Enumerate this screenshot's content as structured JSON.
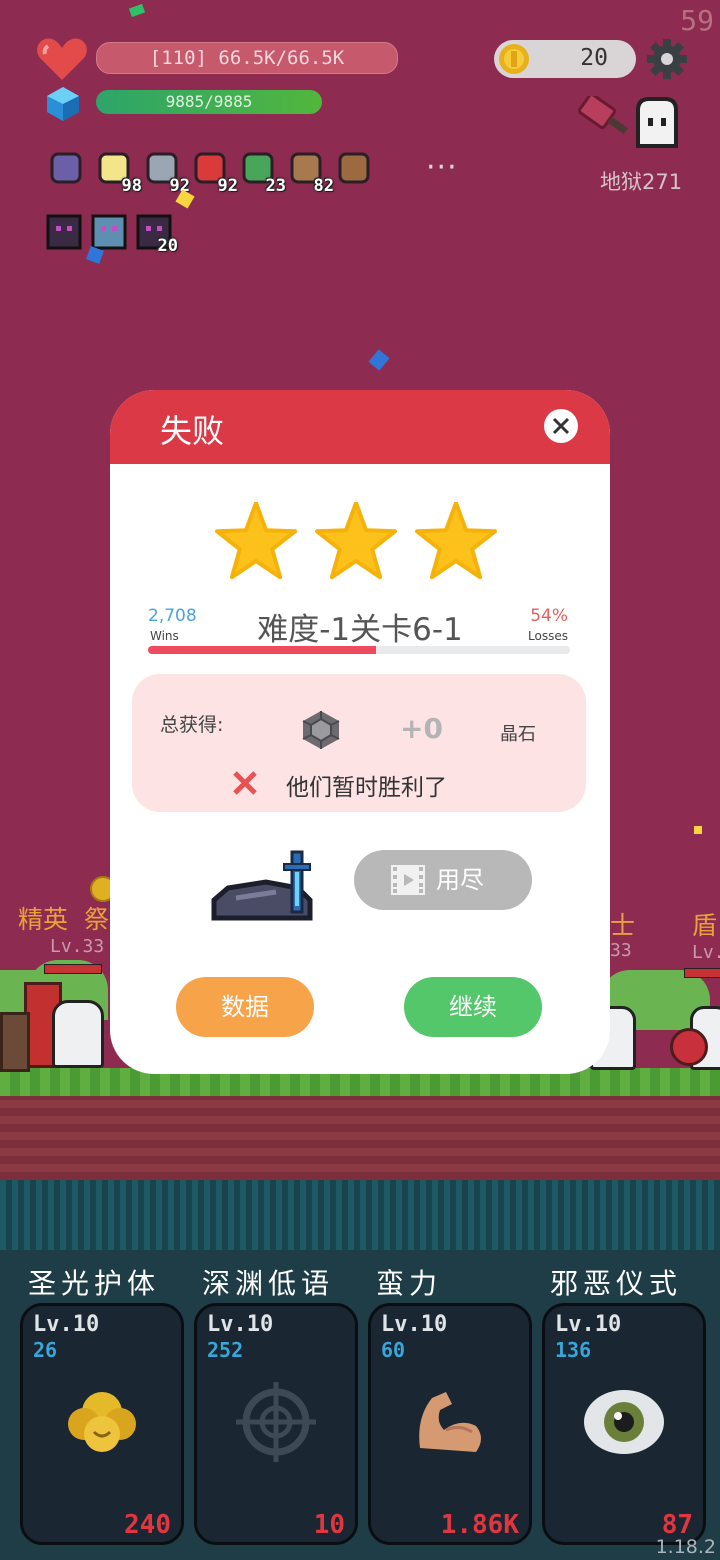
{
  "hud": {
    "fps": "59",
    "hp_text": "[110] 66.5K/66.5K",
    "mana_text": "9885/9885",
    "coins": "20",
    "stage_label": "地狱271",
    "more": "···",
    "items": [
      {
        "icon": "scroll-icon",
        "count": ""
      },
      {
        "icon": "flower-icon",
        "count": "98"
      },
      {
        "icon": "sword-icon",
        "count": "92"
      },
      {
        "icon": "apple-icon",
        "count": "92"
      },
      {
        "icon": "watermelon-icon",
        "count": "23"
      },
      {
        "icon": "shield-icon",
        "count": "82"
      },
      {
        "icon": "meat-icon",
        "count": ""
      }
    ],
    "buffs": [
      {
        "icon": "demon-mask-icon",
        "count": ""
      },
      {
        "icon": "crystal-frame-icon",
        "count": ""
      },
      {
        "icon": "demon-mask-icon",
        "count": "20"
      }
    ]
  },
  "battlefield": {
    "left_labels": [
      "精英",
      "祭"
    ],
    "left_level": "Lv.33",
    "right_labels": [
      "士",
      "盾"
    ],
    "right_level": "33",
    "right_level2": "Lv."
  },
  "dialog": {
    "title": "失败",
    "stars": 3,
    "wins_value": "2,708",
    "wins_label": "Wins",
    "stage": "难度-1关卡6-1",
    "losses_value": "54%",
    "losses_label": "Losses",
    "loss_fraction": 0.54,
    "reward_label": "总获得:",
    "reward_amount": "+0",
    "reward_unit": "晶石",
    "result_message": "他们暂时胜利了",
    "video_button": "用尽",
    "stats_button": "数据",
    "continue_button": "继续"
  },
  "skills": [
    {
      "name": "圣光护体",
      "level": "Lv.10",
      "value": "26",
      "cost": "240",
      "icon": "holy-light-icon"
    },
    {
      "name": "深渊低语",
      "level": "Lv.10",
      "value": "252",
      "cost": "10",
      "icon": "crosshair-icon"
    },
    {
      "name": "蛮力",
      "level": "Lv.10",
      "value": "60",
      "cost": "1.86K",
      "icon": "muscle-icon"
    },
    {
      "name": "邪恶仪式",
      "level": "Lv.10",
      "value": "136",
      "cost": "87",
      "icon": "eye-icon"
    }
  ],
  "version": "1.18.2",
  "colors": {
    "background": "#8d2b50",
    "dialog_header": "#dc3946",
    "stats_button": "#f7a34a",
    "continue_button": "#55c76b",
    "video_button": "#b8b8b8",
    "skill_panel": "#1f3d47"
  }
}
